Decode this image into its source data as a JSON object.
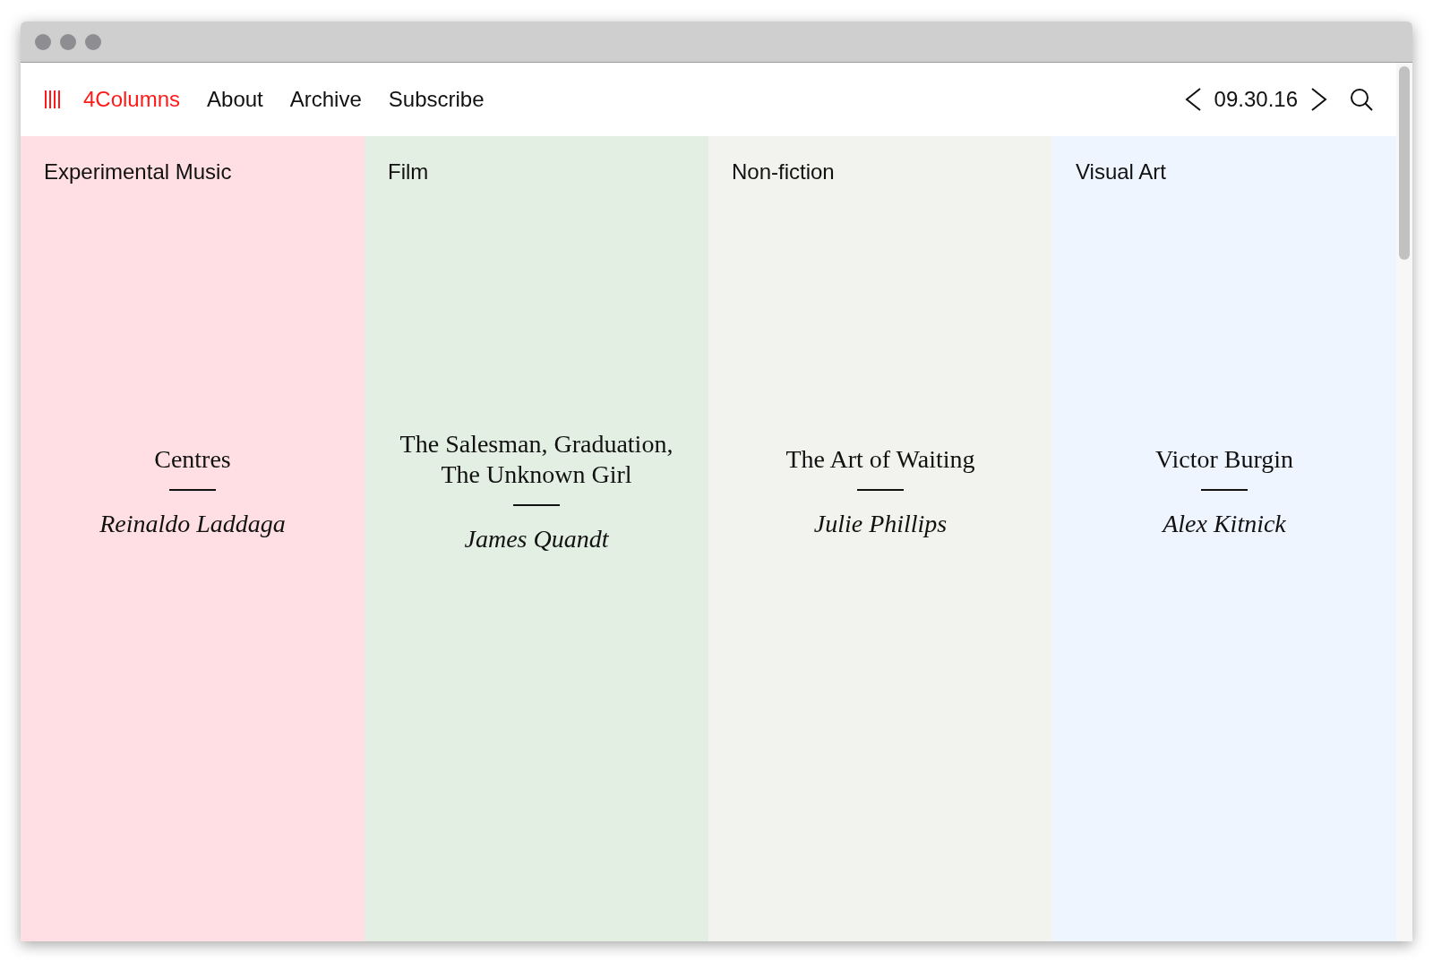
{
  "brand": "4Columns",
  "nav": [
    {
      "label": "About"
    },
    {
      "label": "Archive"
    },
    {
      "label": "Subscribe"
    }
  ],
  "date": "09.30.16",
  "columns": [
    {
      "category": "Experimental Music",
      "title": "Centres",
      "author": "Reinaldo Laddaga",
      "color": "#ffdfe3"
    },
    {
      "category": "Film",
      "title": "The Salesman, Graduation, The Unknown Girl",
      "author": "James Quandt",
      "color": "#e2efe2"
    },
    {
      "category": "Non-fiction",
      "title": "The Art of Waiting",
      "author": "Julie Phillips",
      "color": "#f2f2ee"
    },
    {
      "category": "Visual Art",
      "title": "Victor Burgin",
      "author": "Alex Kitnick",
      "color": "#eef5fe"
    }
  ]
}
